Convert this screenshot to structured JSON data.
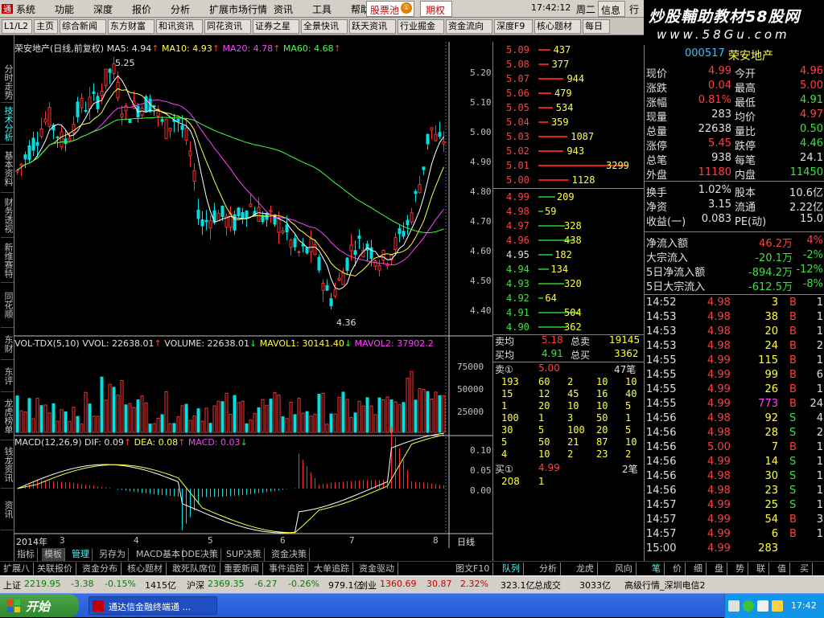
{
  "menu": [
    "系统",
    "功能",
    "深度",
    "报价",
    "分析",
    "扩展市场行情",
    "资讯",
    "工具",
    "帮助"
  ],
  "menu_extra": {
    "pool": "股票池",
    "pool_badge": "①",
    "option": "期权",
    "time": "17:42:12",
    "weekday": "周二",
    "news": "信息",
    "more": "行"
  },
  "banner": {
    "text": "炒股輔助教材58股网",
    "url": "www.58Gu.com"
  },
  "toolbar": [
    "L1/L2",
    "主页",
    "综合新闻",
    "东方财富",
    "和讯资讯",
    "同花资讯",
    "证券之星",
    "全景快讯",
    "跃天资讯",
    "行业掘金",
    "资金流向",
    "深度F9",
    "核心题材",
    "每日"
  ],
  "left_tabs": [
    "分时走势",
    "技术分析",
    "基本资料",
    "财务透视",
    "新维赛特",
    "同花顺",
    "东财",
    "东评",
    "龙虎榜单",
    "钱龙资讯",
    "资讯"
  ],
  "chart": {
    "title": "荣安地产(日线,前复权)",
    "ma5": "MA5: 4.94",
    "ma10": "MA10: 4.93",
    "ma20": "MA20: 4.78",
    "ma60": "MA60: 4.68",
    "high_label": "5.25",
    "low_label": "4.36",
    "price_axis": [
      "5.20",
      "5.10",
      "5.00",
      "4.90",
      "4.80",
      "4.70",
      "4.60",
      "4.50",
      "4.40"
    ],
    "vol_title": "VOL-TDX(5,10)",
    "vwol": "VVOL: 22638.01",
    "volume": "VOLUME: 22638.01",
    "mavol1": "MAVOL1: 30141.40",
    "mavol2": "MAVOL2: 37902.2",
    "vol_axis": [
      "75000",
      "50000",
      "25000"
    ],
    "macd_title": "MACD(12,26,9)",
    "dif": "DIF: 0.09",
    "dea": "DEA: 0.08",
    "macd": "MACD: 0.03",
    "macd_axis": [
      "0.10",
      "0.05",
      "0.00"
    ],
    "date_year": "2014年",
    "date_marks": [
      "3",
      "4",
      "5",
      "6",
      "7",
      "8"
    ],
    "period": "日线"
  },
  "chart_data": {
    "type": "candlestick",
    "ohlc_sample": [
      [
        5.0,
        5.1,
        4.95,
        5.08
      ],
      [
        5.08,
        5.25,
        5.02,
        5.1
      ],
      [
        5.1,
        5.12,
        4.98,
        5.0
      ],
      [
        4.7,
        4.75,
        4.6,
        4.65
      ],
      [
        4.5,
        4.55,
        4.36,
        4.42
      ],
      [
        4.6,
        4.7,
        4.55,
        4.68
      ],
      [
        4.9,
        5.05,
        4.85,
        5.0
      ],
      [
        4.96,
        5.0,
        4.91,
        4.99
      ]
    ],
    "ylim": [
      4.35,
      5.28
    ]
  },
  "bottom_tabs": [
    "指标",
    "模板",
    "管理",
    "另存为",
    "MACD基本",
    "DDE决策",
    "SUP决策",
    "资金决策"
  ],
  "status_tabs": [
    "扩展八",
    "关联报价",
    "资金分布",
    "核心题材",
    "敢死队席位",
    "重要新闻",
    "事件追踪",
    "大单追踪",
    "资金驱动",
    "图文F10"
  ],
  "ob_tabs": [
    "队列",
    "分析",
    "龙虎",
    "风向"
  ],
  "asks": [
    [
      "5.09",
      "437"
    ],
    [
      "5.08",
      "377"
    ],
    [
      "5.07",
      "944"
    ],
    [
      "5.06",
      "479"
    ],
    [
      "5.05",
      "534"
    ],
    [
      "5.04",
      "359"
    ],
    [
      "5.03",
      "1087"
    ],
    [
      "5.02",
      "943"
    ],
    [
      "5.01",
      "3299"
    ],
    [
      "5.00",
      "1128"
    ]
  ],
  "bids": [
    [
      "4.99",
      "209"
    ],
    [
      "4.98",
      "59"
    ],
    [
      "4.97",
      "328"
    ],
    [
      "4.96",
      "438"
    ],
    [
      "4.95",
      "182"
    ],
    [
      "4.94",
      "134"
    ],
    [
      "4.93",
      "320"
    ],
    [
      "4.92",
      "64"
    ],
    [
      "4.91",
      "504"
    ],
    [
      "4.90",
      "362"
    ]
  ],
  "summary": {
    "sell_avg_label": "卖均",
    "sell_avg": "5.18",
    "total_sell_label": "总卖",
    "total_sell": "19145",
    "buy_avg_label": "买均",
    "buy_avg": "4.91",
    "total_buy_label": "总买",
    "total_buy": "3362"
  },
  "queue_sell": {
    "label": "卖①",
    "price": "5.00",
    "count": "47笔",
    "rows": [
      [
        "193",
        "60",
        "2",
        "10",
        "10"
      ],
      [
        "15",
        "12",
        "45",
        "16",
        "40"
      ],
      [
        "1",
        "20",
        "10",
        "10",
        "5"
      ],
      [
        "100",
        "1",
        "3",
        "50",
        "1"
      ],
      [
        "30",
        "5",
        "100",
        "20",
        "5"
      ],
      [
        "5",
        "50",
        "21",
        "87",
        "10"
      ],
      [
        "4",
        "10",
        "2",
        "23",
        "2"
      ]
    ]
  },
  "queue_buy": {
    "label": "买①",
    "price": "4.99",
    "count": "2笔",
    "rows": [
      [
        "208",
        "1"
      ]
    ]
  },
  "stock": {
    "code": "000517",
    "name": "荣安地产"
  },
  "quote": [
    {
      "l1": "现价",
      "v1": "4.99",
      "c1": "up",
      "l2": "今开",
      "v2": "4.96",
      "c2": "up"
    },
    {
      "l1": "涨跌",
      "v1": "0.04",
      "c1": "up",
      "l2": "最高",
      "v2": "5.00",
      "c2": "up"
    },
    {
      "l1": "涨幅",
      "v1": "0.81%",
      "c1": "up",
      "l2": "最低",
      "v2": "4.91",
      "c2": "down"
    },
    {
      "l1": "现量",
      "v1": "283",
      "c1": "white",
      "l2": "均价",
      "v2": "4.97",
      "c2": "up"
    },
    {
      "l1": "总量",
      "v1": "22638",
      "c1": "white",
      "l2": "量比",
      "v2": "0.50",
      "c2": "down"
    },
    {
      "l1": "涨停",
      "v1": "5.45",
      "c1": "up",
      "l2": "跌停",
      "v2": "4.46",
      "c2": "down"
    },
    {
      "l1": "总笔",
      "v1": "938",
      "c1": "white",
      "l2": "每笔",
      "v2": "24.1",
      "c2": "white"
    },
    {
      "l1": "外盘",
      "v1": "11180",
      "c1": "up",
      "l2": "内盘",
      "v2": "11450",
      "c2": "down"
    },
    {
      "l1": "换手",
      "v1": "1.02%",
      "c1": "white",
      "l2": "股本",
      "v2": "10.6亿",
      "c2": "white"
    },
    {
      "l1": "净资",
      "v1": "3.15",
      "c1": "white",
      "l2": "流通",
      "v2": "2.22亿",
      "c2": "white"
    },
    {
      "l1": "收益(一)",
      "v1": "0.083",
      "c1": "white",
      "l2": "PE(动)",
      "v2": "15.0",
      "c2": "white"
    }
  ],
  "flows": [
    {
      "label": "净流入额",
      "value": "46.2万",
      "pct": "4%",
      "c": "up"
    },
    {
      "label": "大宗流入",
      "value": "-20.1万",
      "pct": "-2%",
      "c": "down"
    },
    {
      "label": "5日净流入额",
      "value": "-894.2万",
      "pct": "-12%",
      "c": "down"
    },
    {
      "label": "5日大宗流入",
      "value": "-612.5万",
      "pct": "-8%",
      "c": "down"
    }
  ],
  "ticks": [
    [
      "14:52",
      "4.98",
      "3",
      "B",
      "1"
    ],
    [
      "14:53",
      "4.98",
      "38",
      "B",
      "1"
    ],
    [
      "14:53",
      "4.98",
      "20",
      "B",
      "1"
    ],
    [
      "14:53",
      "4.98",
      "24",
      "B",
      "2"
    ],
    [
      "14:55",
      "4.99",
      "115",
      "B",
      "1"
    ],
    [
      "14:55",
      "4.99",
      "99",
      "B",
      "6"
    ],
    [
      "14:55",
      "4.99",
      "26",
      "B",
      "1"
    ],
    [
      "14:55",
      "4.99",
      "773",
      "B",
      "24"
    ],
    [
      "14:56",
      "4.98",
      "92",
      "S",
      "4"
    ],
    [
      "14:56",
      "4.98",
      "28",
      "S",
      "2"
    ],
    [
      "14:56",
      "5.00",
      "7",
      "B",
      "1"
    ],
    [
      "14:56",
      "4.99",
      "14",
      "S",
      "1"
    ],
    [
      "14:56",
      "4.98",
      "30",
      "S",
      "1"
    ],
    [
      "14:56",
      "4.98",
      "23",
      "S",
      "1"
    ],
    [
      "14:57",
      "4.99",
      "25",
      "S",
      "1"
    ],
    [
      "14:57",
      "4.99",
      "54",
      "B",
      "3"
    ],
    [
      "14:57",
      "4.99",
      "6",
      "B",
      "1"
    ],
    [
      "15:00",
      "4.99",
      "283",
      "",
      ""
    ]
  ],
  "right_tabs": [
    "笔",
    "价",
    "细",
    "盘",
    "势",
    "联",
    "值",
    "买"
  ],
  "indices": [
    {
      "name": "上证",
      "val": "2219.95",
      "chg": "-3.38",
      "pct": "-0.15%",
      "amt": "1415亿"
    },
    {
      "name": "沪深",
      "val": "2369.35",
      "chg": "-6.27",
      "pct": "-0.26%",
      "amt": "979.1亿"
    },
    {
      "name": "创业",
      "val": "1360.69",
      "chg": "30.87",
      "pct": "2.32%",
      "amt": "323.1亿"
    }
  ],
  "index_extra": {
    "total_label": "总成交",
    "total": "3033亿",
    "status": "高级行情_深圳电信2"
  },
  "taskbar": {
    "start": "开始",
    "window": "通达信金融终端通 ...",
    "clock": "17:42"
  }
}
